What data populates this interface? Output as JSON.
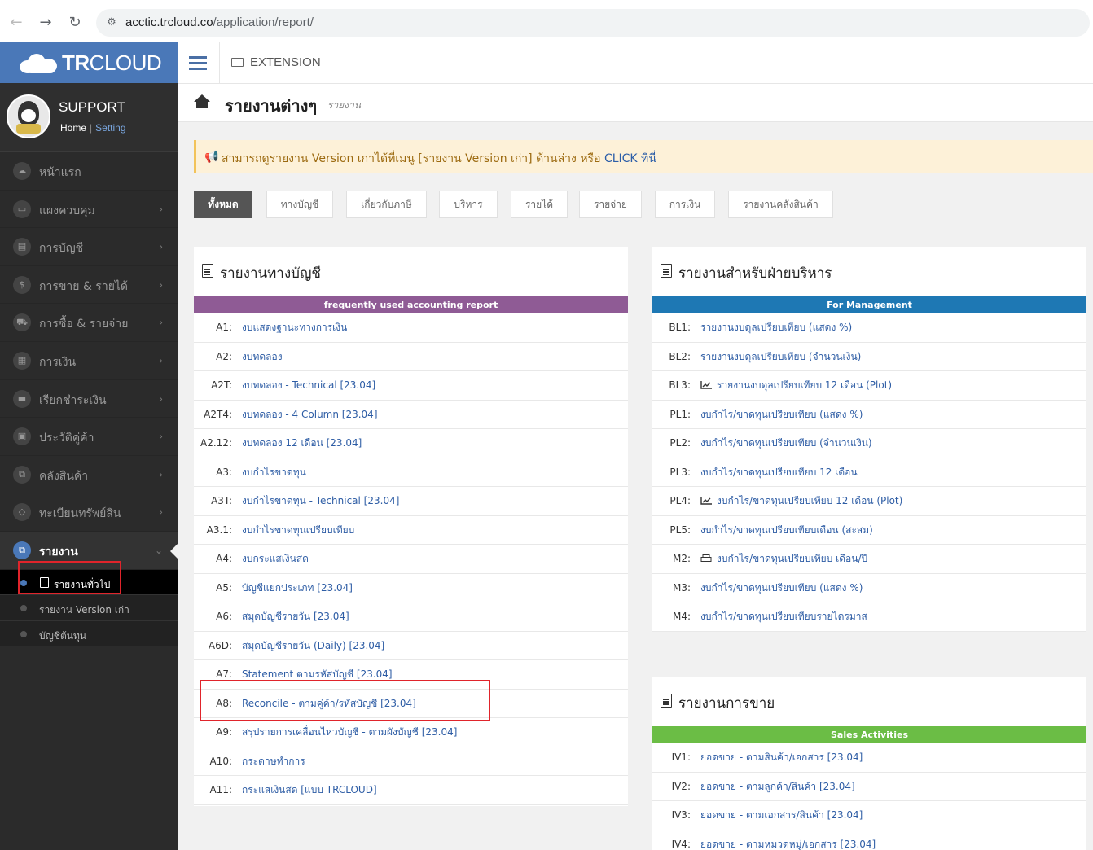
{
  "browser": {
    "url_domain": "acctic.trcloud.co",
    "url_path": "/application/report/"
  },
  "brand": {
    "name_bold": "TR",
    "name_rest": "CLOUD"
  },
  "profile": {
    "name": "SUPPORT",
    "home": "Home",
    "separator": "|",
    "setting": "Setting"
  },
  "sidebar": {
    "items": [
      {
        "label": "หน้าแรก",
        "icon": "cloud-icon"
      },
      {
        "label": "แผงควบคุม",
        "icon": "monitor-icon"
      },
      {
        "label": "การบัญชี",
        "icon": "book-icon"
      },
      {
        "label": "การขาย & รายได้",
        "icon": "dollar-icon"
      },
      {
        "label": "การซื้อ & รายจ่าย",
        "icon": "cart-icon"
      },
      {
        "label": "การเงิน",
        "icon": "calendar-icon"
      },
      {
        "label": "เรียกชำระเงิน",
        "icon": "credit-card-icon"
      },
      {
        "label": "ประวัติคู่ค้า",
        "icon": "address-book-icon"
      },
      {
        "label": "คลังสินค้า",
        "icon": "boxes-icon"
      },
      {
        "label": "ทะเบียนทรัพย์สิน",
        "icon": "diamond-icon"
      }
    ],
    "active": {
      "label": "รายงาน",
      "icon": "report-icon"
    },
    "sub_items": [
      {
        "label": "รายงานทั่วไป"
      },
      {
        "label": "รายงาน Version เก่า"
      },
      {
        "label": "บัญชีต้นทุน"
      }
    ]
  },
  "topbar": {
    "extension": "EXTENSION"
  },
  "header": {
    "title": "รายงานต่างๆ",
    "subtitle": "รายงาน"
  },
  "alert": {
    "text": "สามารถดูรายงาน Version เก่าได้ที่เมนู [รายงาน Version เก่า] ด้านล่าง หรือ ",
    "click": "CLICK",
    "tail": " ที่นี่"
  },
  "filters": [
    "ทั้งหมด",
    "ทางบัญชี",
    "เกี่ยวกับภาษี",
    "บริหาร",
    "รายได้",
    "รายจ่าย",
    "การเงิน",
    "รายงานคลังสินค้า"
  ],
  "colors": {
    "accounting_band": "#8f5b95",
    "management_band": "#1e78b4",
    "sales_band": "#6bbd45",
    "link": "#2e5da5",
    "highlight": "#e0242b"
  },
  "accounting": {
    "title": "รายงานทางบัญชี",
    "band": "frequently used accounting report",
    "rows": [
      {
        "code": "A1:",
        "label": "งบแสดงฐานะทางการเงิน"
      },
      {
        "code": "A2:",
        "label": "งบทดลอง"
      },
      {
        "code": "A2T:",
        "label": "งบทดลอง - Technical [23.04]"
      },
      {
        "code": "A2T4:",
        "label": "งบทดลอง - 4 Column [23.04]"
      },
      {
        "code": "A2.12:",
        "label": "งบทดลอง 12 เดือน [23.04]"
      },
      {
        "code": "A3:",
        "label": "งบกำไรขาดทุน"
      },
      {
        "code": "A3T:",
        "label": "งบกำไรขาดทุน - Technical [23.04]"
      },
      {
        "code": "A3.1:",
        "label": "งบกำไรขาดทุนเปรียบเทียบ"
      },
      {
        "code": "A4:",
        "label": "งบกระแสเงินสด"
      },
      {
        "code": "A5:",
        "label": "บัญชีแยกประเภท [23.04]"
      },
      {
        "code": "A6:",
        "label": "สมุดบัญชีรายวัน [23.04]"
      },
      {
        "code": "A6D:",
        "label": "สมุดบัญชีรายวัน (Daily) [23.04]"
      },
      {
        "code": "A7:",
        "label": "Statement ตามรหัสบัญชี [23.04]"
      },
      {
        "code": "A8:",
        "label": "Reconcile - ตามคู่ค้า/รหัสบัญชี [23.04]"
      },
      {
        "code": "A9:",
        "label": "สรุปรายการเคลื่อนไหวบัญชี - ตามผังบัญชี [23.04]"
      },
      {
        "code": "A10:",
        "label": "กระดาษทำการ"
      },
      {
        "code": "A11:",
        "label": "กระแสเงินสด [แบบ TRCLOUD]"
      }
    ]
  },
  "management": {
    "title": "รายงานสำหรับฝ่ายบริหาร",
    "band": "For Management",
    "rows": [
      {
        "code": "BL1:",
        "label": "รายงานงบดุลเปรียบเทียบ (แสดง %)",
        "icon": ""
      },
      {
        "code": "BL2:",
        "label": "รายงานงบดุลเปรียบเทียบ (จำนวนเงิน)",
        "icon": ""
      },
      {
        "code": "BL3:",
        "label": "รายงานงบดุลเปรียบเทียบ 12 เดือน (Plot)",
        "icon": "line-chart-icon"
      },
      {
        "code": "PL1:",
        "label": "งบกำไร/ขาดทุนเปรียบเทียบ (แสดง %)",
        "icon": ""
      },
      {
        "code": "PL2:",
        "label": "งบกำไร/ขาดทุนเปรียบเทียบ (จำนวนเงิน)",
        "icon": ""
      },
      {
        "code": "PL3:",
        "label": "งบกำไร/ขาดทุนเปรียบเทียบ 12 เดือน",
        "icon": ""
      },
      {
        "code": "PL4:",
        "label": "งบกำไร/ขาดทุนเปรียบเทียบ 12 เดือน (Plot)",
        "icon": "line-chart-icon"
      },
      {
        "code": "PL5:",
        "label": "งบกำไร/ขาดทุนเปรียบเทียบเดือน (สะสม)",
        "icon": ""
      },
      {
        "code": "M2:",
        "label": "งบกำไร/ขาดทุนเปรียบเทียบ เดือน/ปี",
        "icon": "print-icon"
      },
      {
        "code": "M3:",
        "label": "งบกำไร/ขาดทุนเปรียบเทียบ (แสดง %)",
        "icon": ""
      },
      {
        "code": "M4:",
        "label": "งบกำไร/ขาดทุนเปรียบเทียบรายไตรมาส",
        "icon": ""
      }
    ]
  },
  "sales": {
    "title": "รายงานการขาย",
    "band": "Sales Activities",
    "rows": [
      {
        "code": "IV1:",
        "label": "ยอดขาย - ตามสินค้า/เอกสาร [23.04]"
      },
      {
        "code": "IV2:",
        "label": "ยอดขาย - ตามลูกค้า/สินค้า [23.04]"
      },
      {
        "code": "IV3:",
        "label": "ยอดขาย - ตามเอกสาร/สินค้า [23.04]"
      },
      {
        "code": "IV4:",
        "label": "ยอดขาย - ตามหมวดหมู่/เอกสาร [23.04]"
      }
    ]
  }
}
